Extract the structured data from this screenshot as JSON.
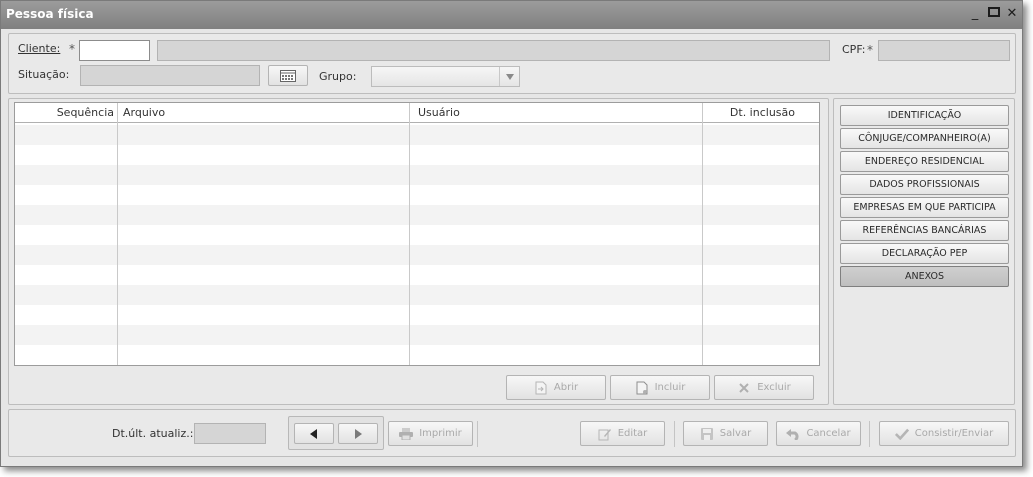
{
  "window": {
    "title": "Pessoa física",
    "minimize": "_",
    "maximize": "□",
    "close": "✕"
  },
  "header": {
    "cliente_label": "Cliente:",
    "required_mark": "*",
    "cliente_value": "",
    "cliente_name": "",
    "cpf_label": "CPF:",
    "cpf_value": "",
    "situacao_label": "Situação:",
    "situacao_value": "",
    "grupo_label": "Grupo:",
    "grupo_value": ""
  },
  "table": {
    "columns": [
      "Sequência",
      "Arquivo",
      "Usuário",
      "Dt. inclusão"
    ],
    "rows": []
  },
  "table_actions": {
    "abrir": "Abrir",
    "incluir": "Incluir",
    "excluir": "Excluir"
  },
  "side_tabs": [
    "IDENTIFICAÇÃO",
    "CÔNJUGE/COMPANHEIRO(A)",
    "ENDEREÇO RESIDENCIAL",
    "DADOS PROFISSIONAIS",
    "EMPRESAS EM QUE PARTICIPA",
    "REFERÊNCIAS BANCÁRIAS",
    "DECLARAÇÃO PEP",
    "ANEXOS"
  ],
  "active_tab": "ANEXOS",
  "footer": {
    "dt_label": "Dt.últ. atualiz.:",
    "dt_value": "",
    "imprimir": "Imprimir",
    "editar": "Editar",
    "salvar": "Salvar",
    "cancelar": "Cancelar",
    "consistir": "Consistir/Enviar"
  }
}
